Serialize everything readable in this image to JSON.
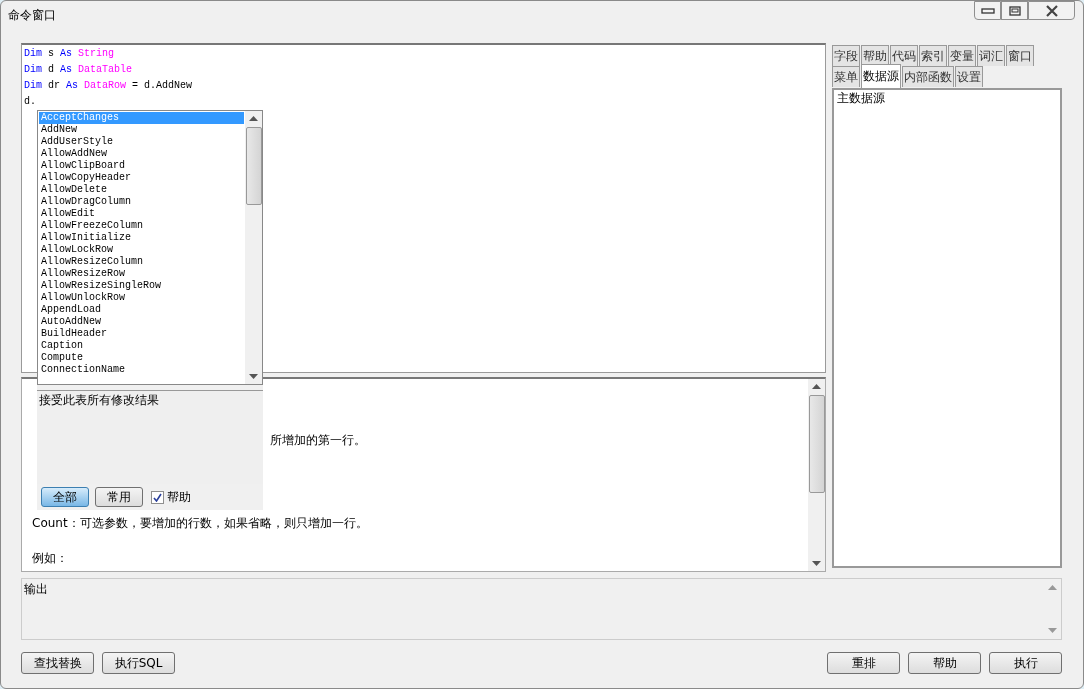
{
  "window": {
    "title": "命令窗口"
  },
  "editor": {
    "lines": [
      [
        {
          "text": "Dim",
          "kind": "keyword"
        },
        {
          "text": " s ",
          "kind": "plain"
        },
        {
          "text": "As",
          "kind": "keyword"
        },
        {
          "text": " String",
          "kind": "type"
        }
      ],
      [
        {
          "text": "Dim",
          "kind": "keyword"
        },
        {
          "text": " d ",
          "kind": "plain"
        },
        {
          "text": "As",
          "kind": "keyword"
        },
        {
          "text": " DataTable",
          "kind": "type"
        }
      ],
      [
        {
          "text": "Dim",
          "kind": "keyword"
        },
        {
          "text": " dr ",
          "kind": "plain"
        },
        {
          "text": "As",
          "kind": "keyword"
        },
        {
          "text": " DataRow",
          "kind": "type"
        },
        {
          "text": " = d.AddNew",
          "kind": "plain"
        }
      ],
      [
        {
          "text": "d.",
          "kind": "plain"
        }
      ]
    ]
  },
  "completion": {
    "items": [
      {
        "text": "AcceptChanges",
        "selected": true
      },
      {
        "text": "AddNew",
        "selected": false
      },
      {
        "text": "AddUserStyle",
        "selected": false
      },
      {
        "text": "AllowAddNew",
        "selected": false
      },
      {
        "text": "AllowClipBoard",
        "selected": false
      },
      {
        "text": "AllowCopyHeader",
        "selected": false
      },
      {
        "text": "AllowDelete",
        "selected": false
      },
      {
        "text": "AllowDragColumn",
        "selected": false
      },
      {
        "text": "AllowEdit",
        "selected": false
      },
      {
        "text": "AllowFreezeColumn",
        "selected": false
      },
      {
        "text": "AllowInitialize",
        "selected": false
      },
      {
        "text": "AllowLockRow",
        "selected": false
      },
      {
        "text": "AllowResizeColumn",
        "selected": false
      },
      {
        "text": "AllowResizeRow",
        "selected": false
      },
      {
        "text": "AllowResizeSingleRow",
        "selected": false
      },
      {
        "text": "AllowUnlockRow",
        "selected": false
      },
      {
        "text": "AppendLoad",
        "selected": false
      },
      {
        "text": "AutoAddNew",
        "selected": false
      },
      {
        "text": "BuildHeader",
        "selected": false
      },
      {
        "text": "Caption",
        "selected": false
      },
      {
        "text": "Compute",
        "selected": false
      },
      {
        "text": "ConnectionName",
        "selected": false
      }
    ],
    "description": "接受此表所有修改结果",
    "filters": [
      {
        "label": "全部",
        "selected": true
      },
      {
        "label": "常用",
        "selected": false
      }
    ],
    "help_checkbox": {
      "label": "帮助",
      "checked": true
    }
  },
  "help": {
    "lines": [
      {
        "text": "所增加的第一行。",
        "kind": "partial"
      },
      {
        "text": "Count：可选参数，要增加的行数，如果省略，则只增加一行。",
        "kind": "full"
      },
      {
        "text": "例如：",
        "kind": "full"
      }
    ]
  },
  "side_panel": {
    "tab_rows": [
      [
        {
          "label": "字段",
          "selected": false
        },
        {
          "label": "帮助",
          "selected": false
        },
        {
          "label": "代码",
          "selected": false
        },
        {
          "label": "索引",
          "selected": false
        },
        {
          "label": "变量",
          "selected": false
        },
        {
          "label": "词汇",
          "selected": false
        },
        {
          "label": "窗口",
          "selected": false
        }
      ],
      [
        {
          "label": "菜单",
          "selected": false
        },
        {
          "label": "数据源",
          "selected": true
        },
        {
          "label": "内部函数",
          "selected": false
        },
        {
          "label": "设置",
          "selected": false
        }
      ]
    ],
    "items": [
      "主数据源"
    ]
  },
  "output": {
    "label": "输出"
  },
  "buttons_left": [
    "查找替换",
    "执行SQL"
  ],
  "buttons_right": [
    "重排",
    "帮助",
    "执行"
  ]
}
